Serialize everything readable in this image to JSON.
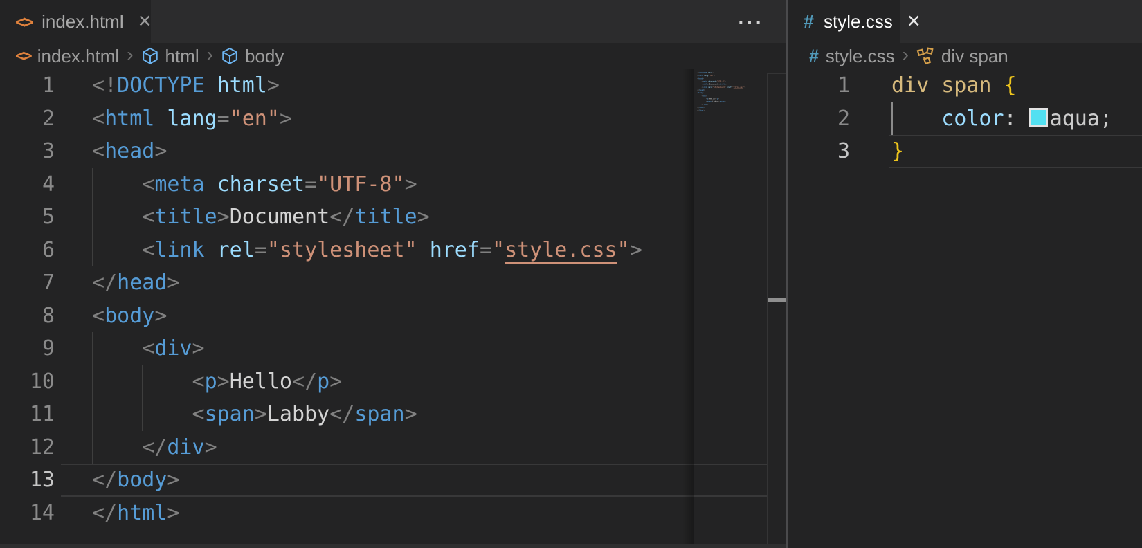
{
  "icons": {
    "html_glyph": "<>",
    "css_glyph": "#"
  },
  "colors": {
    "editor_bg": "#232324",
    "tabbar_bg": "#2c2c2d",
    "active_tab_bg": "#232324",
    "group_border": "#4a4a4c",
    "punctuation": "#808080",
    "tag": "#569cd6",
    "attribute": "#9cdcfe",
    "string": "#ce9178",
    "plain_text": "#d4d4d4",
    "css_selector": "#d7ba7d",
    "brace": "#eec51d",
    "css_property": "#9cdcfe",
    "css_value": "#cccccc",
    "swatch_fill": "#52e0f1",
    "swatch_border": "#e2e2e2",
    "line_number": "#8a8a8a",
    "line_number_active": "#c6c6c6",
    "indent_guide": "#3e3e3e",
    "indent_guide_active": "#8b8b8b",
    "current_line_border": "#383839",
    "tab_text": "#a9a9a9",
    "tab_text_focused": "#ffffff",
    "breadcrumb_text": "#9d9d9d",
    "html_icon": "#e0823d",
    "css_icon": "#519aba",
    "symbol_cube_icon": "#6cb4f0",
    "symbol_rule_icon": "#d7a14b",
    "overview_marker": "#8f8f8f"
  },
  "left_group": {
    "tab": {
      "label": "index.html",
      "close_glyph": "✕"
    },
    "overflow_label": "⋯",
    "breadcrumb": {
      "file": "index.html",
      "separator": "›",
      "node1": "html",
      "node2": "body"
    },
    "lines": [
      {
        "n": 1,
        "g": 0,
        "segs": [
          [
            "p",
            "<!"
          ],
          [
            "tag",
            "DOCTYPE"
          ],
          [
            "txt",
            " "
          ],
          [
            "attr",
            "html"
          ],
          [
            "p",
            ">"
          ]
        ]
      },
      {
        "n": 2,
        "g": 0,
        "segs": [
          [
            "p",
            "<"
          ],
          [
            "tag",
            "html"
          ],
          [
            "txt",
            " "
          ],
          [
            "attr",
            "lang"
          ],
          [
            "p",
            "="
          ],
          [
            "str",
            "\"en\""
          ],
          [
            "p",
            ">"
          ]
        ]
      },
      {
        "n": 3,
        "g": 0,
        "segs": [
          [
            "p",
            "<"
          ],
          [
            "tag",
            "head"
          ],
          [
            "p",
            ">"
          ]
        ]
      },
      {
        "n": 4,
        "g": 1,
        "segs": [
          [
            "txt",
            "    "
          ],
          [
            "p",
            "<"
          ],
          [
            "tag",
            "meta"
          ],
          [
            "txt",
            " "
          ],
          [
            "attr",
            "charset"
          ],
          [
            "p",
            "="
          ],
          [
            "str",
            "\"UTF-8\""
          ],
          [
            "p",
            ">"
          ]
        ]
      },
      {
        "n": 5,
        "g": 1,
        "segs": [
          [
            "txt",
            "    "
          ],
          [
            "p",
            "<"
          ],
          [
            "tag",
            "title"
          ],
          [
            "p",
            ">"
          ],
          [
            "txt",
            "Document"
          ],
          [
            "p",
            "</"
          ],
          [
            "tag",
            "title"
          ],
          [
            "p",
            ">"
          ]
        ]
      },
      {
        "n": 6,
        "g": 1,
        "segs": [
          [
            "txt",
            "    "
          ],
          [
            "p",
            "<"
          ],
          [
            "tag",
            "link"
          ],
          [
            "txt",
            " "
          ],
          [
            "attr",
            "rel"
          ],
          [
            "p",
            "="
          ],
          [
            "str",
            "\"stylesheet\""
          ],
          [
            "txt",
            " "
          ],
          [
            "attr",
            "href"
          ],
          [
            "p",
            "="
          ],
          [
            "str",
            "\""
          ],
          [
            "lnk",
            "style.css"
          ],
          [
            "str",
            "\""
          ],
          [
            "p",
            ">"
          ]
        ]
      },
      {
        "n": 7,
        "g": 0,
        "segs": [
          [
            "p",
            "</"
          ],
          [
            "tag",
            "head"
          ],
          [
            "p",
            ">"
          ]
        ]
      },
      {
        "n": 8,
        "g": 0,
        "segs": [
          [
            "p",
            "<"
          ],
          [
            "tag",
            "body"
          ],
          [
            "p",
            ">"
          ]
        ]
      },
      {
        "n": 9,
        "g": 1,
        "segs": [
          [
            "txt",
            "    "
          ],
          [
            "p",
            "<"
          ],
          [
            "tag",
            "div"
          ],
          [
            "p",
            ">"
          ]
        ]
      },
      {
        "n": 10,
        "g": 2,
        "segs": [
          [
            "txt",
            "        "
          ],
          [
            "p",
            "<"
          ],
          [
            "tag",
            "p"
          ],
          [
            "p",
            ">"
          ],
          [
            "txt",
            "Hello"
          ],
          [
            "p",
            "</"
          ],
          [
            "tag",
            "p"
          ],
          [
            "p",
            ">"
          ]
        ]
      },
      {
        "n": 11,
        "g": 2,
        "segs": [
          [
            "txt",
            "        "
          ],
          [
            "p",
            "<"
          ],
          [
            "tag",
            "span"
          ],
          [
            "p",
            ">"
          ],
          [
            "txt",
            "Labby"
          ],
          [
            "p",
            "</"
          ],
          [
            "tag",
            "span"
          ],
          [
            "p",
            ">"
          ]
        ]
      },
      {
        "n": 12,
        "g": 1,
        "segs": [
          [
            "txt",
            "    "
          ],
          [
            "p",
            "</"
          ],
          [
            "tag",
            "div"
          ],
          [
            "p",
            ">"
          ]
        ]
      },
      {
        "n": 13,
        "g": 0,
        "cur": true,
        "segs": [
          [
            "p",
            "</"
          ],
          [
            "tag",
            "body"
          ],
          [
            "p",
            ">"
          ]
        ]
      },
      {
        "n": 14,
        "g": 0,
        "segs": [
          [
            "p",
            "</"
          ],
          [
            "tag",
            "html"
          ],
          [
            "p",
            ">"
          ]
        ]
      }
    ]
  },
  "right_group": {
    "tab": {
      "label": "style.css",
      "close_glyph": "✕"
    },
    "breadcrumb": {
      "file": "style.css",
      "separator": "›",
      "node1": "div span"
    },
    "lines": [
      {
        "n": 1,
        "g": 0,
        "segs": [
          [
            "sel",
            "div"
          ],
          [
            "txt",
            " "
          ],
          [
            "sel",
            "span"
          ],
          [
            "txt",
            " "
          ],
          [
            "brc",
            "{"
          ]
        ]
      },
      {
        "n": 2,
        "g": 1,
        "gActive": true,
        "segs": [
          [
            "txt",
            "    "
          ],
          [
            "prop",
            "color"
          ],
          [
            "op",
            ":"
          ],
          [
            "txt",
            " "
          ],
          [
            "swatch",
            "aqua"
          ],
          [
            "val",
            "aqua"
          ],
          [
            "op",
            ";"
          ]
        ]
      },
      {
        "n": 3,
        "g": 0,
        "cur": true,
        "segs": [
          [
            "brc",
            "}"
          ]
        ]
      }
    ]
  }
}
